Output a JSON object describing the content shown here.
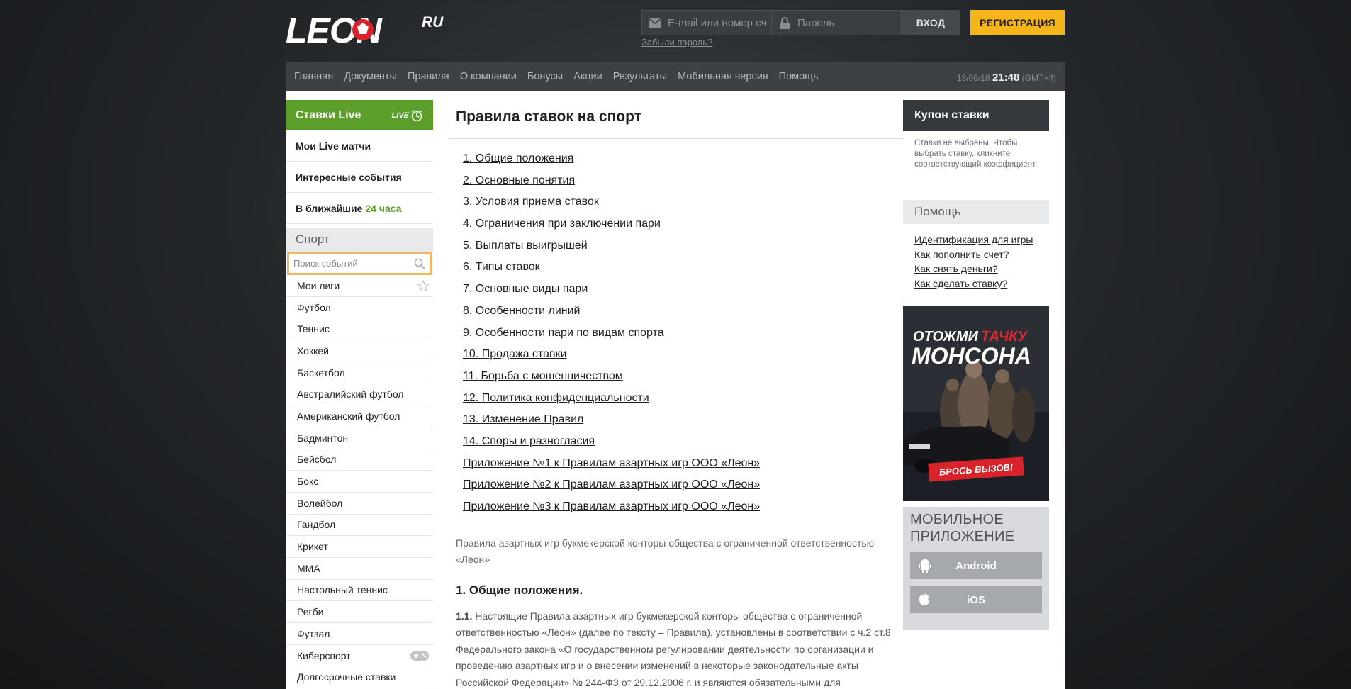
{
  "brand": {
    "logo_text": "LEON",
    "logo_suffix": "RU"
  },
  "login": {
    "email_placeholder": "E-mail или номер сче",
    "password_placeholder": "Пароль",
    "login_label": "ВХОД",
    "register_label": "РЕГИСТРАЦИЯ",
    "forgot_label": "Забыли пароль?"
  },
  "nav": {
    "items": [
      "Главная",
      "Документы",
      "Правила",
      "О компании",
      "Бонусы",
      "Акции",
      "Результаты",
      "Мобильная версия",
      "Помощь"
    ],
    "date": "13/06/18",
    "time": "21:48",
    "timezone": "(GMT+4)"
  },
  "left": {
    "live_title": "Ставки Live",
    "live_badge": "LIVE",
    "rows": [
      "Мои Live матчи",
      "Интересные события"
    ],
    "soon_label": "В ближайшие",
    "soon_link": "24 часа",
    "sport_title": "Спорт",
    "search_placeholder": "Поиск событий",
    "sports": [
      "Мои лиги",
      "Футбол",
      "Теннис",
      "Хоккей",
      "Баскетбол",
      "Австралийский футбол",
      "Американский футбол",
      "Бадминтон",
      "Бейсбол",
      "Бокс",
      "Волейбол",
      "Гандбол",
      "Крикет",
      "MMA",
      "Настольный теннис",
      "Регби",
      "Футзал",
      "Киберспорт",
      "Долгосрочные ставки"
    ]
  },
  "main": {
    "title": "Правила ставок на спорт",
    "toc": [
      "1. Общие положения",
      "2. Основные понятия",
      "3. Условия приема ставок",
      "4. Ограничения при заключении пари",
      "5. Выплаты выигрышей",
      "6. Типы ставок",
      "7. Основные виды пари",
      "8. Особенности линий",
      "9. Особенности пари по видам спорта",
      "10. Продажа ставки",
      "11. Борьба с мошенничеством",
      "12. Политика конфиденциальности",
      "13. Изменение Правил",
      "14. Споры и разногласия",
      "Приложение №1 к Правилам азартных игр ООО «Леон»",
      "Приложение №2 к Правилам азартных игр ООО «Леон»",
      "Приложение №3 к Правилам азартных игр ООО «Леон»"
    ],
    "intro": "Правила азартных игр букмекерской конторы общества с ограниченной ответственностью «Леон»",
    "section_title": "1. Общие положения.",
    "para_num": "1.1.",
    "para_text": "Настоящие Правила азартных игр букмекерской конторы общества с ограниченной ответственностью «Леон» (далее по тексту – Правила), установлены в соответствии с ч.2 ст.8 Федерального закона «О государственном регулировании деятельности по организации и проведению азартных игр и о внесении изменений в некоторые законодательные акты Российской Федерации» № 244-ФЗ от 29.12.2006 г. и являются обязательными для"
  },
  "right": {
    "coupon_title": "Купон ставки",
    "coupon_text": "Ставки не выбраны. Чтобы выбрать ставку, кликните соответствующий коэффициент.",
    "help_title": "Помощь",
    "help_links": [
      "Идентификация для игры",
      "Как пополнить счет?",
      "Как снять деньги?",
      "Как сделать ставку?"
    ],
    "banner": {
      "line1a": "ОТОЖМИ",
      "line1b": "ТАЧКУ",
      "line2": "МОНСОНА",
      "cta": "БРОСЬ ВЫЗОВ!"
    },
    "mobile_title_1": "МОБИЛЬНОЕ",
    "mobile_title_2": "ПРИЛОЖЕНИЕ",
    "android_label": "Android",
    "ios_label": "iOS"
  },
  "colors": {
    "live_green": "#5c9e2a",
    "accent_yellow": "#f5b51b",
    "search_border": "#f3b661",
    "nav_bg": "#3d4045"
  }
}
